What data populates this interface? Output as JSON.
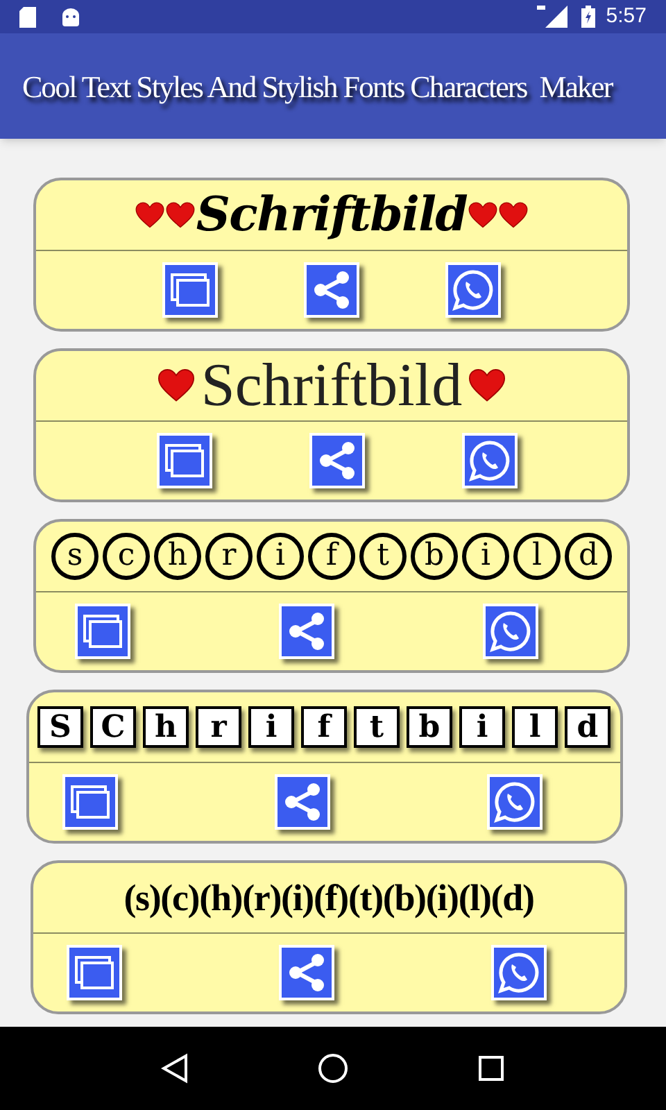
{
  "status_bar": {
    "time": "5:57"
  },
  "app_bar": {
    "title": "Cool Text Styles And Stylish Fonts Characters  Maker"
  },
  "cards": [
    {
      "kind": "hearts_double",
      "text": "Schriftbild"
    },
    {
      "kind": "hearts_single",
      "text": "Schriftbild"
    },
    {
      "kind": "circled",
      "letters": [
        "s",
        "c",
        "h",
        "r",
        "i",
        "f",
        "t",
        "b",
        "i",
        "l",
        "d"
      ]
    },
    {
      "kind": "boxed",
      "letters": [
        "S",
        "C",
        "h",
        "r",
        "i",
        "f",
        "t",
        "b",
        "i",
        "l",
        "d"
      ]
    },
    {
      "kind": "parenthesized",
      "text": "(s)(c)(h)(r)(i)(f)(t)(b)(i)(l)(d)"
    }
  ]
}
